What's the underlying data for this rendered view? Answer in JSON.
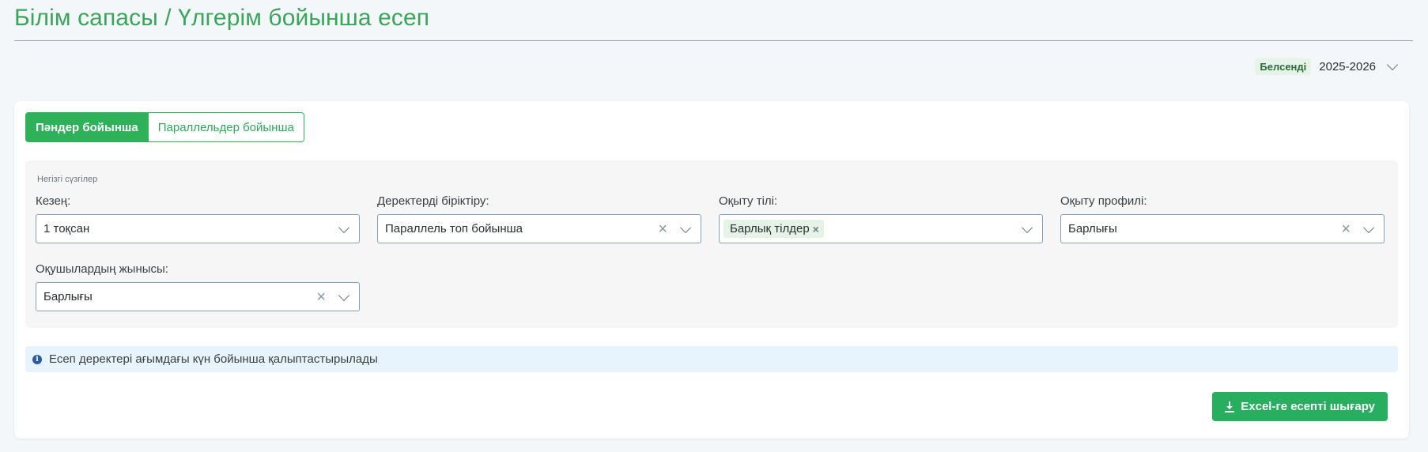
{
  "page": {
    "title": "Білім сапасы / Үлгерім бойынша есеп"
  },
  "year_selector": {
    "badge": "Белсенді",
    "value": "2025-2026"
  },
  "tabs": [
    {
      "label": "Пәндер бойынша",
      "active": true
    },
    {
      "label": "Параллельдер бойынша",
      "active": false
    }
  ],
  "filters": {
    "caption": "Негізгі сүзгілер",
    "period": {
      "label": "Кезең:",
      "value": "1 тоқсан"
    },
    "merge": {
      "label": "Деректерді біріктіру:",
      "value": "Параллель топ бойынша"
    },
    "language": {
      "label": "Оқыту тілі:",
      "chip": "Барлық тілдер"
    },
    "profile": {
      "label": "Оқыту профилі:",
      "value": "Барлығы"
    },
    "gender": {
      "label": "Оқушылардың жынысы:",
      "value": "Барлығы"
    }
  },
  "info": {
    "text": "Есеп деректері ағымдағы күн бойынша қалыптастырылады"
  },
  "export": {
    "label": "Excel-ге есепті шығару"
  },
  "colors": {
    "accent": "#2fb15a",
    "title": "#3aa55a",
    "info_bg": "#e8f4fd"
  }
}
